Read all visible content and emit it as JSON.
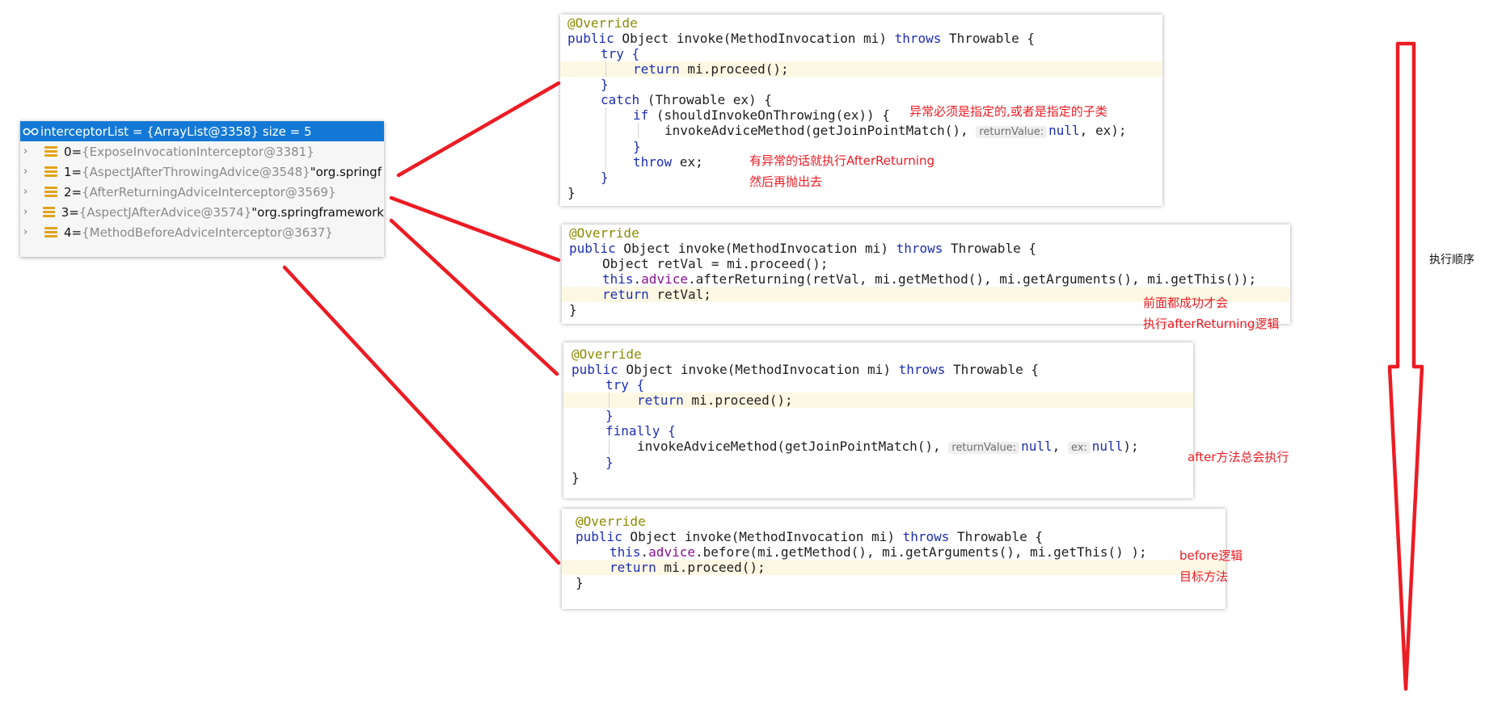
{
  "debugger": {
    "header": "interceptorList = {ArrayList@3358}  size = 5",
    "items": [
      {
        "index": "0",
        "eq": " = ",
        "type": "{ExposeInvocationInterceptor@3381}",
        "extra": ""
      },
      {
        "index": "1",
        "eq": " = ",
        "type": "{AspectJAfterThrowingAdvice@3548}",
        "extra": " \"org.springf"
      },
      {
        "index": "2",
        "eq": " = ",
        "type": "{AfterReturningAdviceInterceptor@3569}",
        "extra": ""
      },
      {
        "index": "3",
        "eq": " = ",
        "type": "{AspectJAfterAdvice@3574}",
        "extra": " \"org.springframework"
      },
      {
        "index": "4",
        "eq": " = ",
        "type": "{MethodBeforeAdviceInterceptor@3637}",
        "extra": ""
      }
    ]
  },
  "code_blocks": {
    "after_throwing": {
      "annotation": "@Override",
      "signature_public": "public",
      "signature_mid": " Object invoke(MethodInvocation mi) ",
      "signature_throws": "throws",
      "signature_end": " Throwable {",
      "try_kw": "try",
      "try_brace": " {",
      "return_kw": "return",
      "return_rest": " mi.proceed();",
      "close_brace": "}",
      "catch_kw": "catch",
      "catch_rest": " (Throwable ex) {",
      "if_kw": "if",
      "if_rest": " (shouldInvokeOnThrowing(ex)) {",
      "invoke_call": "invokeAdviceMethod(getJoinPointMatch(), ",
      "hint_return_value": "returnValue:",
      "null_kw": "null",
      "invoke_end": ", ex);",
      "throw_kw": "throw",
      "throw_rest": " ex;",
      "inner_close": "}",
      "catch_close": "}",
      "method_close": "}"
    },
    "after_returning": {
      "annotation": "@Override",
      "signature_public": "public",
      "signature_mid": " Object invoke(MethodInvocation mi) ",
      "signature_throws": "throws",
      "signature_end": " Throwable {",
      "line1": "Object retVal = mi.proceed();",
      "this_kw": "this",
      "dot": ".",
      "advice_field": "advice",
      "line2_rest": ".afterReturning(retVal, mi.getMethod(), mi.getArguments(), mi.getThis());",
      "return_kw": "return",
      "return_rest": " retVal;",
      "method_close": "}"
    },
    "after": {
      "annotation": "@Override",
      "signature_public": "public",
      "signature_mid": " Object invoke(MethodInvocation mi) ",
      "signature_throws": "throws",
      "signature_end": " Throwable {",
      "try_kw": "try",
      "try_brace": " {",
      "return_kw": "return",
      "return_rest": " mi.proceed();",
      "try_close": "}",
      "finally_kw": "finally",
      "finally_brace": " {",
      "invoke_call": "invokeAdviceMethod(getJoinPointMatch(), ",
      "hint_return_value": "returnValue:",
      "null_kw": "null",
      "comma": ", ",
      "hint_ex": "ex:",
      "null_kw2": "null",
      "invoke_end": ");",
      "finally_close": "}",
      "method_close": "}"
    },
    "before": {
      "annotation": "@Override",
      "signature_public": "public",
      "signature_mid": " Object invoke(MethodInvocation mi) ",
      "signature_throws": "throws",
      "signature_end": " Throwable {",
      "this_kw": "this",
      "dot": ".",
      "advice_field": "advice",
      "line1_rest": ".before(mi.getMethod(), mi.getArguments(), mi.getThis() );",
      "return_kw": "return",
      "return_rest": " mi.proceed();",
      "method_close": "}"
    }
  },
  "notes": {
    "exception_type": "异常必须是指定的,或者是指定的子类",
    "after_throwing_1": "有异常的话就执行AfterReturning",
    "after_throwing_2": "然后再抛出去",
    "after_returning_1": "前面都成功才会",
    "after_returning_2": "执行afterReturning逻辑",
    "after_always": "after方法总会执行",
    "before_logic": "before逻辑",
    "target_method": "目标方法",
    "execution_order": "执行顺序"
  },
  "colors": {
    "annotation_red": "#ec1c24",
    "debug_header_blue": "#1479d6",
    "keyword_blue": "#1d2eb5",
    "annotation_olive": "#8b8b00",
    "field_purple": "#871094",
    "highlight_line": "#fdf8e3"
  }
}
